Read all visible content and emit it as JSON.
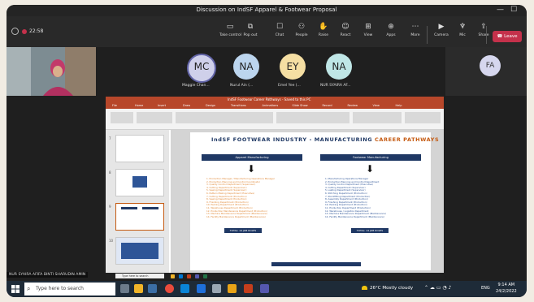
{
  "window": {
    "title": "Discussion on IndSF Apparel & Footwear Proposal",
    "controls": [
      "—",
      "☐"
    ]
  },
  "meeting": {
    "elapsed": "22:58",
    "toolbar": [
      {
        "label": "Take control",
        "icon": "take-control-icon",
        "glyph": "▭"
      },
      {
        "label": "Pop out",
        "icon": "pop-out-icon",
        "glyph": "⧉"
      },
      {
        "label": "Chat",
        "icon": "chat-icon",
        "glyph": "☐"
      },
      {
        "label": "People",
        "icon": "people-icon",
        "glyph": "⚇"
      },
      {
        "label": "Raise",
        "icon": "raise-hand-icon",
        "glyph": "✋"
      },
      {
        "label": "React",
        "icon": "react-icon",
        "glyph": "☺"
      },
      {
        "label": "View",
        "icon": "view-icon",
        "glyph": "⊞"
      },
      {
        "label": "Apps",
        "icon": "apps-icon",
        "glyph": "⊕"
      },
      {
        "label": "More",
        "icon": "more-icon",
        "glyph": "⋯"
      },
      {
        "label": "Camera",
        "icon": "camera-icon",
        "glyph": "▶"
      },
      {
        "label": "Mic",
        "icon": "mic-icon",
        "glyph": "♆"
      },
      {
        "label": "Share",
        "icon": "share-icon",
        "glyph": "⇪"
      }
    ],
    "leave_label": "Leave"
  },
  "participants": [
    {
      "initials": "MC",
      "name": "Maggie Chan...",
      "color": "#cfd0ea"
    },
    {
      "initials": "NA",
      "name": "Nurul Ain (...",
      "color": "#bcd5ee"
    },
    {
      "initials": "EY",
      "name": "Emel Yee (...",
      "color": "#f5dfa3"
    },
    {
      "initials": "NA",
      "name": "NUR SYAIRA AF...",
      "color": "#bfe6e6"
    }
  ],
  "side_participant": {
    "initials": "FA"
  },
  "presenter_name": "NUR SYAIRA AFIFA BINTI SHARUDIN AMIN",
  "powerpoint": {
    "title": "IndSF Footwear Career Pathways - Saved to this PC",
    "tabs": [
      "File",
      "Home",
      "Insert",
      "Draw",
      "Design",
      "Transitions",
      "Animations",
      "Slide Show",
      "Record",
      "Review",
      "View",
      "Help"
    ],
    "thumbnail_numbers": [
      "7",
      "8",
      "9",
      "10"
    ],
    "slide": {
      "title_prefix": "IndSF FOOTWEAR INDUSTRY - MANUFACTURING ",
      "title_accent": "CAREER PATHWAYS",
      "left_header": "Apparel Manufacturing",
      "right_header": "Footwear Manufacturing",
      "left_items": [
        "1.  Production Manager / Manufacturing Operations Manager",
        "2.  Production Planning and Control Coordinator",
        "3.  Quality Control Department (Supervisor)",
        "4.  Cutting Department (Supervisor)",
        "5.  Sewing Department (Supervisor)",
        "6.  Pattern Making Department (Executive)",
        "7.  Cutting Department (Production)",
        "8.  Sewing Department (Production)",
        "9.  Finishing Department (Production)",
        "10. Packing Department (Production)",
        "11. Warehouse Department (Production)",
        "12. Production Maintenance Department (Production)",
        "13. Machine Maintenance Department (Maintenance)",
        "14. Facility Maintenance Department (Maintenance)"
      ],
      "right_items": [
        "1.  Manufacturing Operations Manager",
        "2.  Production Planning and Control Department",
        "3.  Quality Control Department (Executive)",
        "4.  Cutting Department (Supervisor)",
        "5.  Lasting Department (Supervisor)",
        "6.  Stitching Department (Production)",
        "7.  Stockfitting Department (Production)",
        "8.  Assembly Department (Production)",
        "9.  Finishing Department (Production)",
        "10. Packing Department (Production)",
        "11. Production Department (Production)",
        "12. Warehouse / Logistics Department",
        "13. Machine Maintenance Department (Maintenance)",
        "14. Facility Maintenance Department (Maintenance)"
      ],
      "left_button": "TOTAL: 14 JOB ROLES",
      "right_button": "TOTAL: 14 JOB ROLES"
    },
    "inner_search": "Type here to search"
  },
  "taskbar": {
    "search_placeholder": "Type here to search",
    "weather": "26°C  Mostly cloudy",
    "language": "ENG",
    "time": "9:14 AM",
    "date": "24/2/2022"
  }
}
